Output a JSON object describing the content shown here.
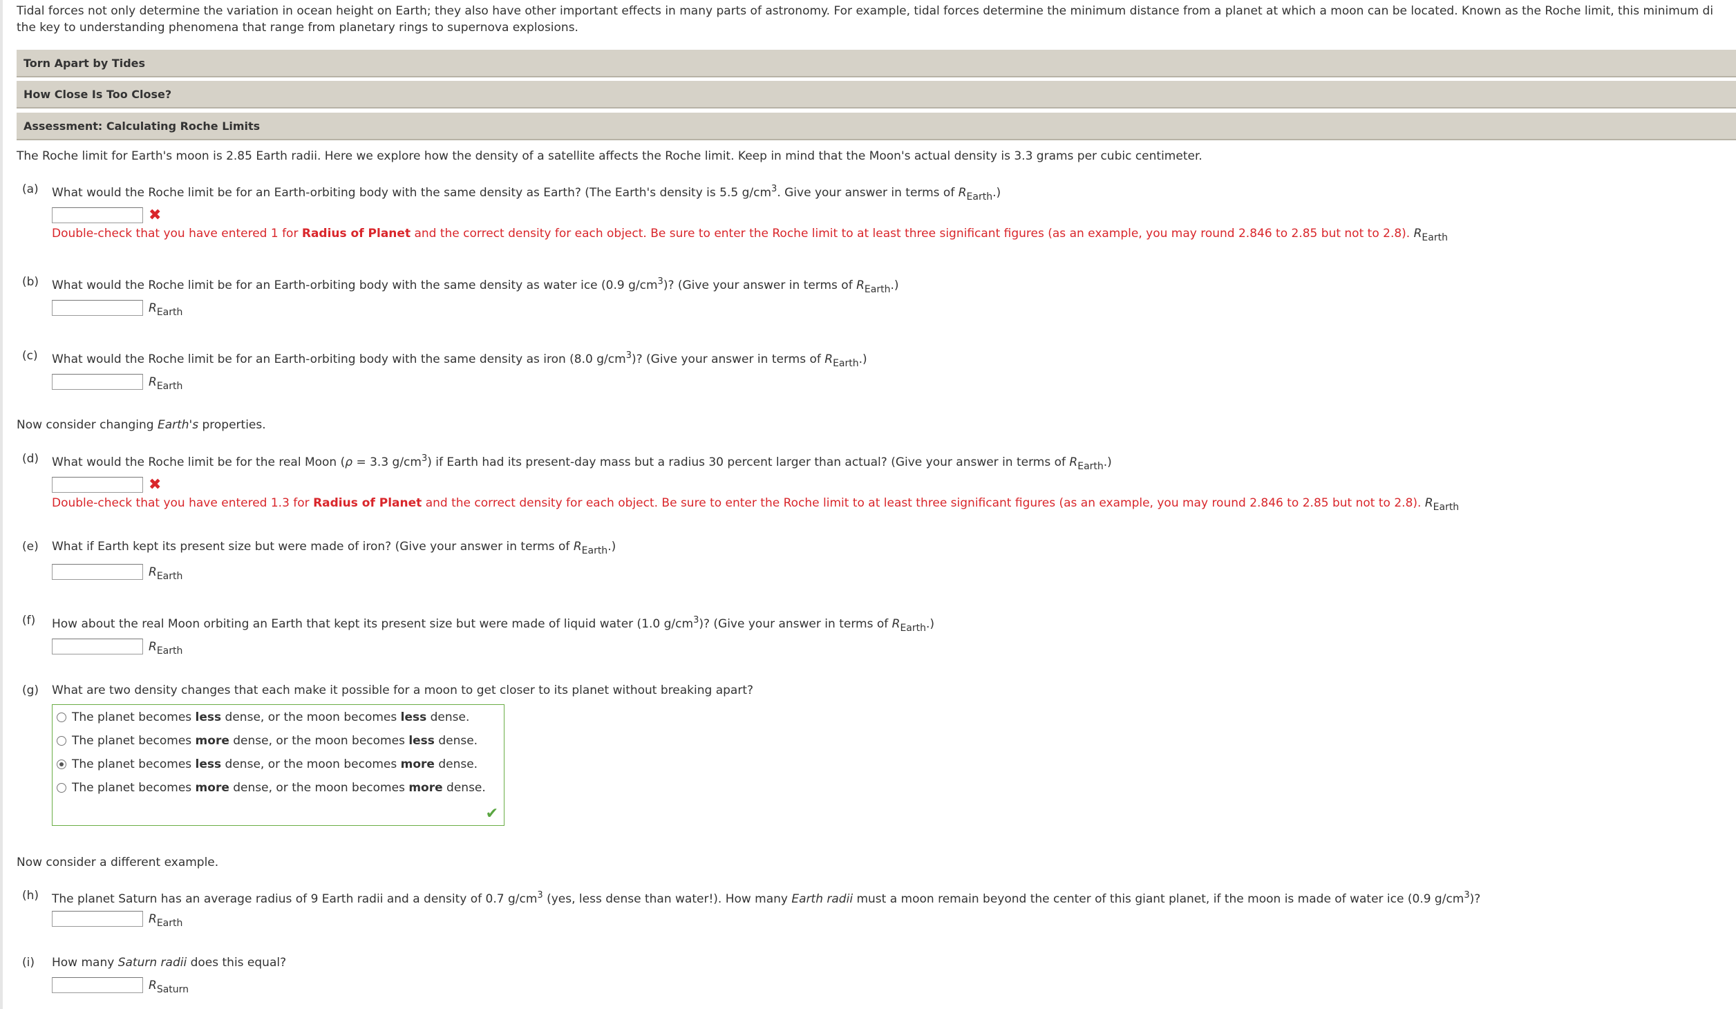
{
  "intro": {
    "line1": "Tidal forces not only determine the variation in ocean height on Earth; they also have other important effects in many parts of astronomy. For example, tidal forces determine the minimum distance from a planet at which a moon can be located. Known as the Roche limit, this minimum di",
    "line2": "the key to understanding phenomena that range from planetary rings to supernova explosions."
  },
  "sections": [
    {
      "label": "Torn Apart by Tides"
    },
    {
      "label": "How Close Is Too Close?"
    },
    {
      "label": "Assessment: Calculating Roche Limits"
    }
  ],
  "preamble": "The Roche limit for Earth's moon is 2.85 Earth radii. Here we explore how the density of a satellite affects the Roche limit. Keep in mind that the Moon's actual density is 3.3 grams per cubic centimeter.",
  "units": {
    "R": "R",
    "earth": "Earth",
    "saturn": "Saturn"
  },
  "questions": {
    "a": {
      "label": "(a)",
      "text_pre": "What would the Roche limit be for an Earth-orbiting body with the same density as Earth? (The Earth's density is 5.5 g/cm",
      "sup": "3",
      "text_post": ". Give your answer in terms of ",
      "tail": ".)",
      "value": "",
      "feedback_pre": "Double-check that you have entered 1 for ",
      "feedback_bold": "Radius of Planet",
      "feedback_post": " and the correct density for each object. Be sure to enter the Roche limit to at least three significant figures (as an example, you may round 2.846 to 2.85 but not to 2.8)."
    },
    "b": {
      "label": "(b)",
      "text_pre": "What would the Roche limit be for an Earth-orbiting body with the same density as water ice (0.9 g/cm",
      "sup": "3",
      "text_post": ")? (Give your answer in terms of ",
      "tail": ".)",
      "value": ""
    },
    "c": {
      "label": "(c)",
      "text_pre": "What would the Roche limit be for an Earth-orbiting body with the same density as iron (8.0 g/cm",
      "sup": "3",
      "text_post": ")? (Give your answer in terms of ",
      "tail": ".)",
      "value": ""
    },
    "mid1": {
      "pre": "Now consider changing ",
      "ital": "Earth's",
      "post": " properties."
    },
    "d": {
      "label": "(d)",
      "text_pre": "What would the Roche limit be for the real Moon (",
      "rho": "ρ",
      "text_mid": " = 3.3 g/cm",
      "sup": "3",
      "text_post": ") if Earth had its present-day mass but a radius 30 percent larger than actual? (Give your answer in terms of ",
      "tail": ".)",
      "value": "",
      "feedback_pre": "Double-check that you have entered 1.3 for ",
      "feedback_bold": "Radius of Planet",
      "feedback_post": " and the correct density for each object. Be sure to enter the Roche limit to at least three significant figures (as an example, you may round 2.846 to 2.85 but not to 2.8)."
    },
    "e": {
      "label": "(e)",
      "text_pre": "What if Earth kept its present size but were made of iron? (Give your answer in terms of ",
      "tail": ".)",
      "value": ""
    },
    "f": {
      "label": "(f)",
      "text_pre": "How about the real Moon orbiting an Earth that kept its present size but were made of liquid water (1.0 g/cm",
      "sup": "3",
      "text_post": ")? (Give your answer in terms of ",
      "tail": ".)",
      "value": ""
    },
    "g": {
      "label": "(g)",
      "text": "What are two density changes that each make it possible for a moon to get closer to its planet without breaking apart?",
      "options": [
        {
          "p1": "The planet becomes ",
          "b1": "less",
          "p2": " dense, or the moon becomes ",
          "b2": "less",
          "p3": " dense."
        },
        {
          "p1": "The planet becomes ",
          "b1": "more",
          "p2": " dense, or the moon becomes ",
          "b2": "less",
          "p3": " dense."
        },
        {
          "p1": "The planet becomes ",
          "b1": "less",
          "p2": " dense, or the moon becomes ",
          "b2": "more",
          "p3": " dense."
        },
        {
          "p1": "The planet becomes ",
          "b1": "more",
          "p2": " dense, or the moon becomes ",
          "b2": "more",
          "p3": " dense."
        }
      ],
      "selected_index": 2
    },
    "mid2": "Now consider a different example.",
    "h": {
      "label": "(h)",
      "text_pre": "The planet Saturn has an average radius of 9 Earth radii and a density of 0.7 g/cm",
      "sup": "3",
      "text_mid": " (yes, less dense than water!). How many ",
      "ital": "Earth radii",
      "text_post": " must a moon remain beyond the center of this giant planet, if the moon is made of water ice (0.9 g/cm",
      "sup2": "3",
      "tail": ")?",
      "value": ""
    },
    "i": {
      "label": "(i)",
      "text_pre": "How many ",
      "ital": "Saturn radii",
      "text_post": " does this equal?",
      "value": ""
    }
  }
}
